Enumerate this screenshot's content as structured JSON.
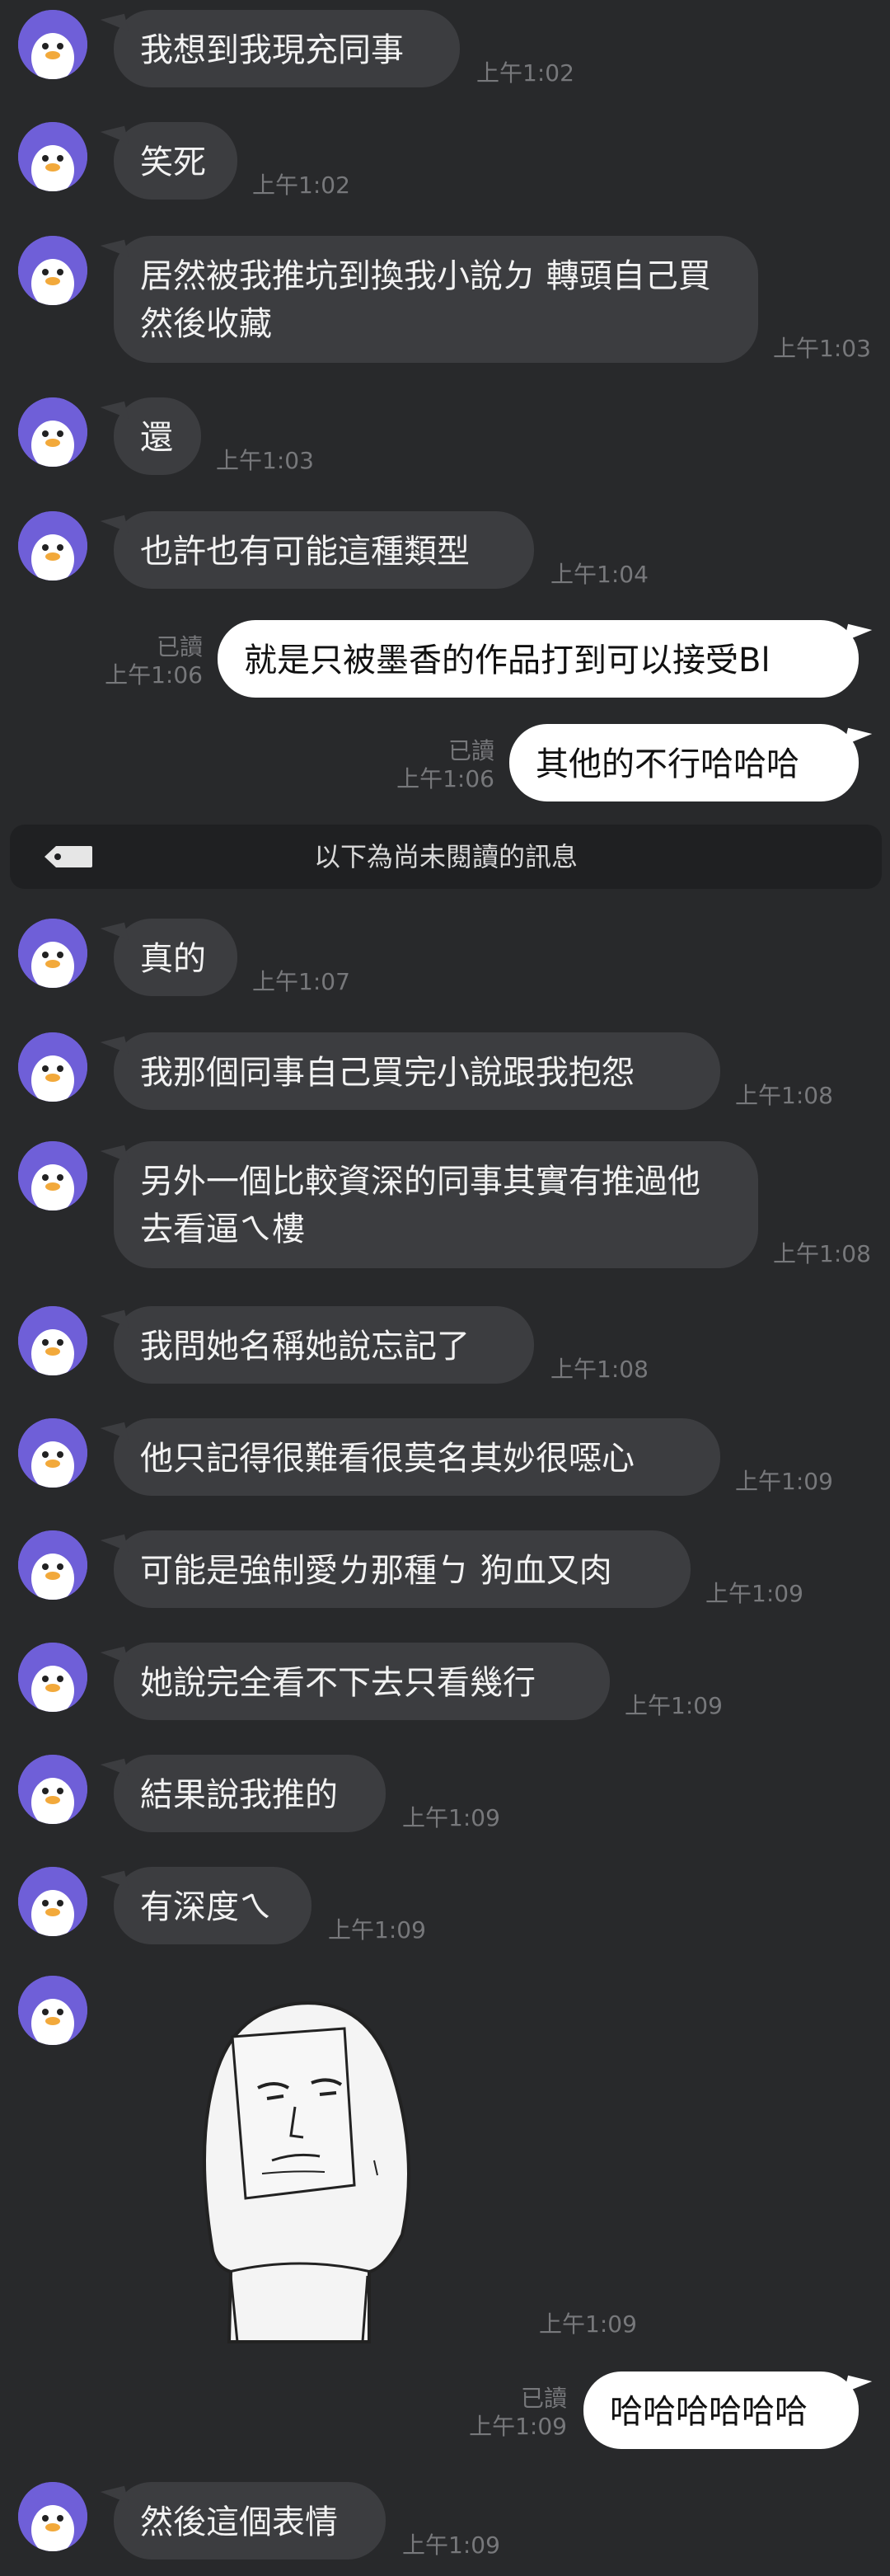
{
  "messages": [
    {
      "text": "我想到我現充同事",
      "time": "上午1:02"
    },
    {
      "text": "笑死",
      "time": "上午1:02"
    },
    {
      "text": "居然被我推坑到換我小說ㄉ 轉頭自己買然後收藏",
      "time": "上午1:03"
    },
    {
      "text": "還",
      "time": "上午1:03"
    },
    {
      "text": "也許也有可能這種類型",
      "time": "上午1:04"
    },
    {
      "text": "就是只被墨香的作品打到可以接受Bl",
      "time": "上午1:06",
      "status": "已讀"
    },
    {
      "text": "其他的不行哈哈哈",
      "time": "上午1:06",
      "status": "已讀"
    },
    {
      "text": "真的",
      "time": "上午1:07"
    },
    {
      "text": "我那個同事自己買完小說跟我抱怨",
      "time": "上午1:08"
    },
    {
      "text": "另外一個比較資深的同事其實有推過他去看逼ㄟ樓",
      "time": "上午1:08"
    },
    {
      "text": "我問她名稱她說忘記了",
      "time": "上午1:08"
    },
    {
      "text": "他只記得很難看很莫名其妙很噁心",
      "time": "上午1:09"
    },
    {
      "text": "可能是強制愛ㄌ那種ㄅ 狗血又肉",
      "time": "上午1:09"
    },
    {
      "text": "她說完全看不下去只看幾行",
      "time": "上午1:09"
    },
    {
      "text": "結果說我推的",
      "time": "上午1:09"
    },
    {
      "text": "有深度ㄟ",
      "time": "上午1:09"
    },
    {
      "text": "",
      "time": "上午1:09"
    },
    {
      "text": "哈哈哈哈哈哈",
      "time": "上午1:09",
      "status": "已讀"
    },
    {
      "text": "然後這個表情",
      "time": "上午1:09"
    }
  ],
  "divider": {
    "text": "以下為尚未閱讀的訊息"
  },
  "sticker": {
    "icon": "meme-face-sticker"
  },
  "colors": {
    "background": "#28292b",
    "incoming": "#3c3d40",
    "outgoing": "#ffffff",
    "avatar": "#6f5fd8",
    "beak": "#f2a93b"
  }
}
